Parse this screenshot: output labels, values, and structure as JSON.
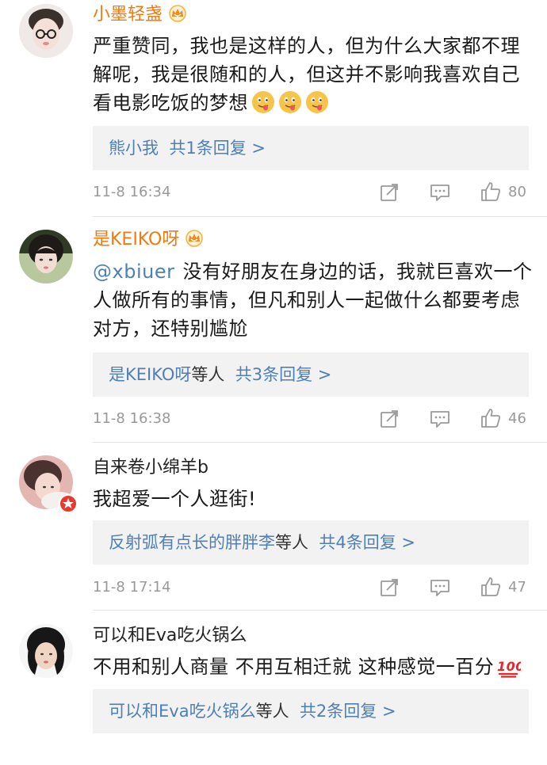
{
  "comments": [
    {
      "username": "小墨轻盏",
      "vip": true,
      "text": "严重赞同，我也是这样的人，但为什么大家都不理解呢，我是很随和的人，但这并不影响我喜欢自己看电影吃饭的梦想",
      "emojis": [
        "tongue-emoji",
        "tongue-emoji",
        "tongue-emoji"
      ],
      "reply_names": "熊小我",
      "reply_middle": "",
      "reply_count": "共1条回复 >",
      "time": "11-8 16:34",
      "likes": "80"
    },
    {
      "username": "是KEIKO呀",
      "vip": true,
      "mention": "@xbiuer",
      "text": "没有好朋友在身边的话，我就巨喜欢一个人做所有的事情，但凡和别人一起做什么都要考虑对方，还特别尴尬",
      "reply_names": "是KEIKO呀",
      "reply_middle": "等人",
      "reply_count": "共3条回复 >",
      "time": "11-8 16:38",
      "likes": "46"
    },
    {
      "username": "自来卷小绵羊b",
      "vip": false,
      "text": "我超爱一个人逛街!",
      "reply_names": "反射弧有点长的胖胖李",
      "reply_middle": "等人",
      "reply_count": "共4条回复 >",
      "time": "11-8 17:14",
      "likes": "47"
    },
    {
      "username": "可以和Eva吃火锅么",
      "vip": false,
      "text": "不用和别人商量 不用互相迁就 这种感觉一百分",
      "emojis": [
        "hundred-points-emoji"
      ],
      "reply_names": "可以和Eva吃火锅么",
      "reply_middle": "等人",
      "reply_count": "共2条回复 >",
      "time": "",
      "likes": ""
    }
  ],
  "colors": {
    "vip_name": "#f07a10",
    "link": "#4f7fb5",
    "meta": "#999999",
    "reply_bg": "#f2f2f2"
  }
}
